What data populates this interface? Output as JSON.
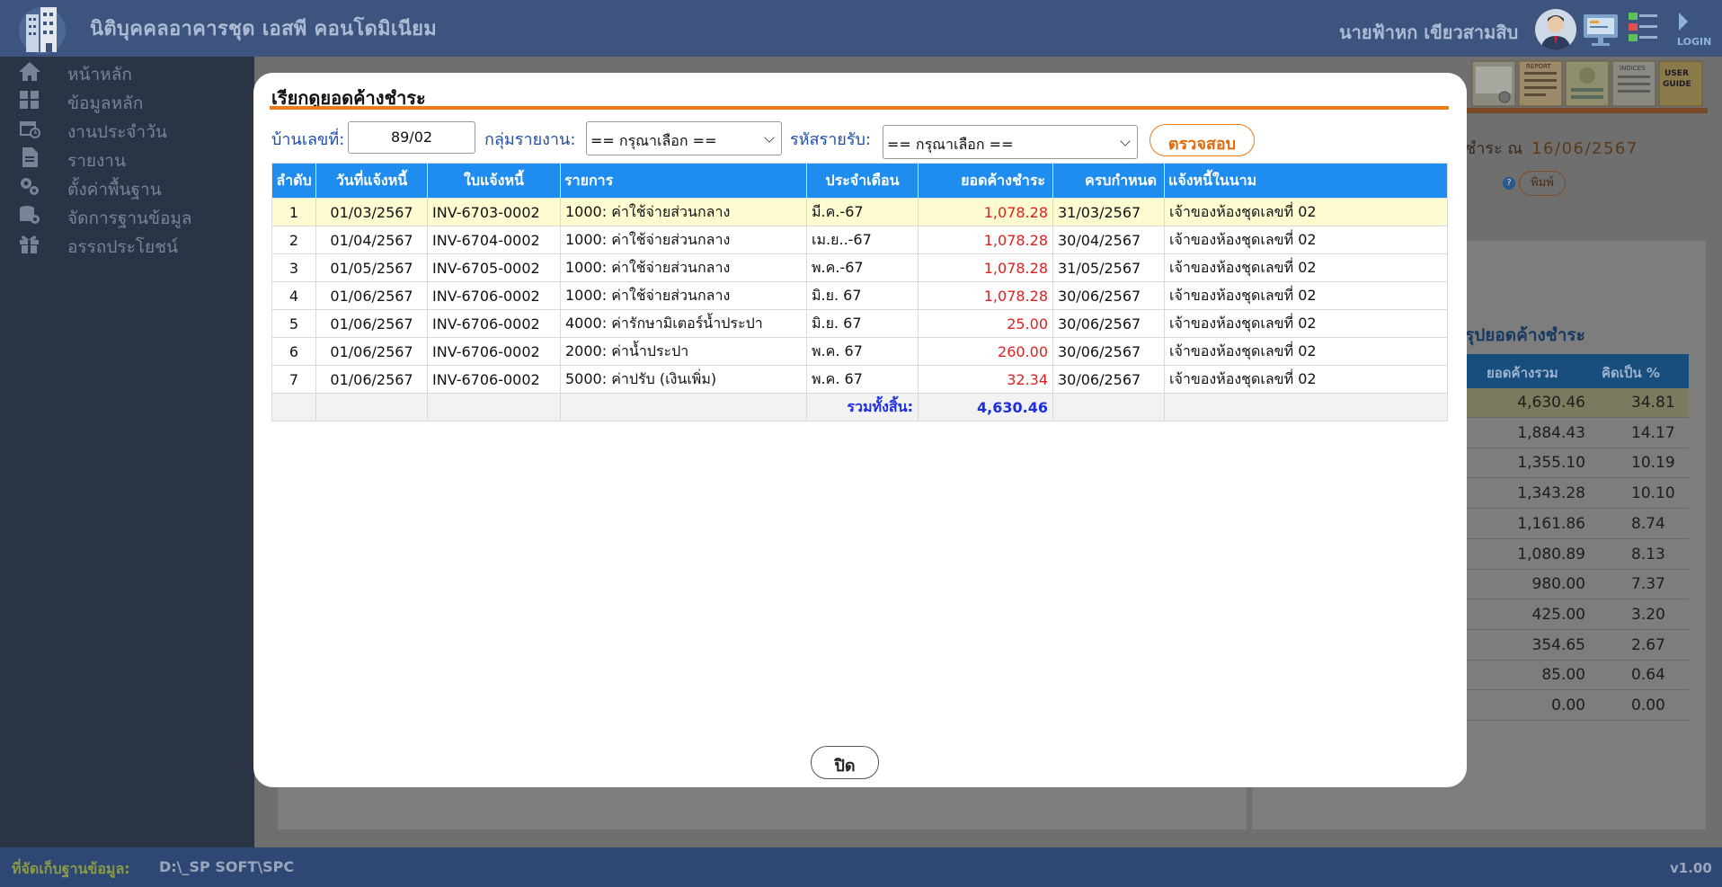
{
  "app": {
    "title": "นิติบุคคลอาคารชุด เอสพี คอนโดมิเนียม",
    "user_name": "นายฟ้าหก เขียวสามสิบ",
    "top_icons": [
      "avatar-icon",
      "monitor-icon",
      "settings-chart-icon",
      "logout-icon"
    ]
  },
  "sidebar": {
    "items": [
      {
        "label": "หน้าหลัก",
        "icon": "home-icon"
      },
      {
        "label": "ข้อมูลหลัก",
        "icon": "grid-icon"
      },
      {
        "label": "งานประจำวัน",
        "icon": "calendar-icon"
      },
      {
        "label": "รายงาน",
        "icon": "document-icon"
      },
      {
        "label": "ตั้งค่าพื้นฐาน",
        "icon": "gears-icon"
      },
      {
        "label": "จัดการฐานข้อมูล",
        "icon": "database-icon"
      },
      {
        "label": "อรรถประโยชน์",
        "icon": "gift-icon"
      }
    ]
  },
  "background": {
    "toolbar_icons": [
      "browser-icon",
      "report-icon",
      "checklist-icon",
      "indices-icon",
      "user-guide-icon"
    ],
    "report_label": "REPORT",
    "indices_label": "INDICES",
    "user_guide_label": "USER GUIDE",
    "date_label": "ชำระ ณ",
    "date_value": "16/06/2567",
    "print_label": "พิมพ์",
    "summary_title": "รุปยอดค้างชำระ",
    "summary_headers": [
      "ยอดค้างรวม",
      "คิดเป็น %"
    ],
    "summary_rows": [
      {
        "amount": "4,630.46",
        "percent": "34.81"
      },
      {
        "amount": "1,884.43",
        "percent": "14.17"
      },
      {
        "amount": "1,355.10",
        "percent": "10.19"
      },
      {
        "amount": "1,343.28",
        "percent": "10.10"
      },
      {
        "amount": "1,161.86",
        "percent": "8.74"
      },
      {
        "amount": "1,080.89",
        "percent": "8.13"
      },
      {
        "amount": "980.00",
        "percent": "7.37"
      },
      {
        "amount": "425.00",
        "percent": "3.20"
      },
      {
        "amount": "354.65",
        "percent": "2.67"
      },
      {
        "amount": "85.00",
        "percent": "0.64"
      },
      {
        "amount": "0.00",
        "percent": "0.00"
      }
    ]
  },
  "footer": {
    "db_label": "ที่จัดเก็บฐานข้อมูล:",
    "db_path": "D:\\_SP SOFT\\SPC",
    "version": "v1.00"
  },
  "modal": {
    "title": "เรียกดูยอดค้างชำระ",
    "house_label": "บ้านเลขที่:",
    "house_value": "89/02",
    "group_label": "กลุ่มรายงาน:",
    "group_selected": "== กรุณาเลือก ==",
    "code_label": "รหัสรายรับ:",
    "code_selected": "== กรุณาเลือก ==",
    "check_button": "ตรวจสอบ",
    "close_button": "ปิด",
    "table": {
      "headers": [
        "ลำดับ",
        "วันที่แจ้งหนี้",
        "ใบแจ้งหนี้",
        "รายการ",
        "ประจำเดือน",
        "ยอดค้างชำระ",
        "ครบกำหนด",
        "แจ้งหนี้ในนาม"
      ],
      "rows": [
        {
          "no": "1",
          "date": "01/03/2567",
          "invoice": "INV-6703-0002",
          "item": "1000: ค่าใช้จ่ายส่วนกลาง",
          "month": "มี.ค.-67",
          "amount": "1,078.28",
          "due": "31/03/2567",
          "name": "เจ้าของห้องชุดเลขที่ 02"
        },
        {
          "no": "2",
          "date": "01/04/2567",
          "invoice": "INV-6704-0002",
          "item": "1000: ค่าใช้จ่ายส่วนกลาง",
          "month": "เม.ย..-67",
          "amount": "1,078.28",
          "due": "30/04/2567",
          "name": "เจ้าของห้องชุดเลขที่ 02"
        },
        {
          "no": "3",
          "date": "01/05/2567",
          "invoice": "INV-6705-0002",
          "item": "1000: ค่าใช้จ่ายส่วนกลาง",
          "month": "พ.ค.-67",
          "amount": "1,078.28",
          "due": "31/05/2567",
          "name": "เจ้าของห้องชุดเลขที่ 02"
        },
        {
          "no": "4",
          "date": "01/06/2567",
          "invoice": "INV-6706-0002",
          "item": "1000: ค่าใช้จ่ายส่วนกลาง",
          "month": "มิ.ย. 67",
          "amount": "1,078.28",
          "due": "30/06/2567",
          "name": "เจ้าของห้องชุดเลขที่ 02"
        },
        {
          "no": "5",
          "date": "01/06/2567",
          "invoice": "INV-6706-0002",
          "item": "4000: ค่ารักษามิเตอร์น้ำประปา",
          "month": "มิ.ย. 67",
          "amount": "25.00",
          "due": "30/06/2567",
          "name": "เจ้าของห้องชุดเลขที่ 02"
        },
        {
          "no": "6",
          "date": "01/06/2567",
          "invoice": "INV-6706-0002",
          "item": "2000: ค่าน้ำประปา",
          "month": "พ.ค. 67",
          "amount": "260.00",
          "due": "30/06/2567",
          "name": "เจ้าของห้องชุดเลขที่ 02"
        },
        {
          "no": "7",
          "date": "01/06/2567",
          "invoice": "INV-6706-0002",
          "item": "5000: ค่าปรับ (เงินเพิ่ม)",
          "month": "พ.ค. 67",
          "amount": "32.34",
          "due": "30/06/2567",
          "name": "เจ้าของห้องชุดเลขที่ 02"
        }
      ],
      "total_label": "รวมทั้งสิ้น:",
      "total_value": "4,630.46"
    }
  }
}
